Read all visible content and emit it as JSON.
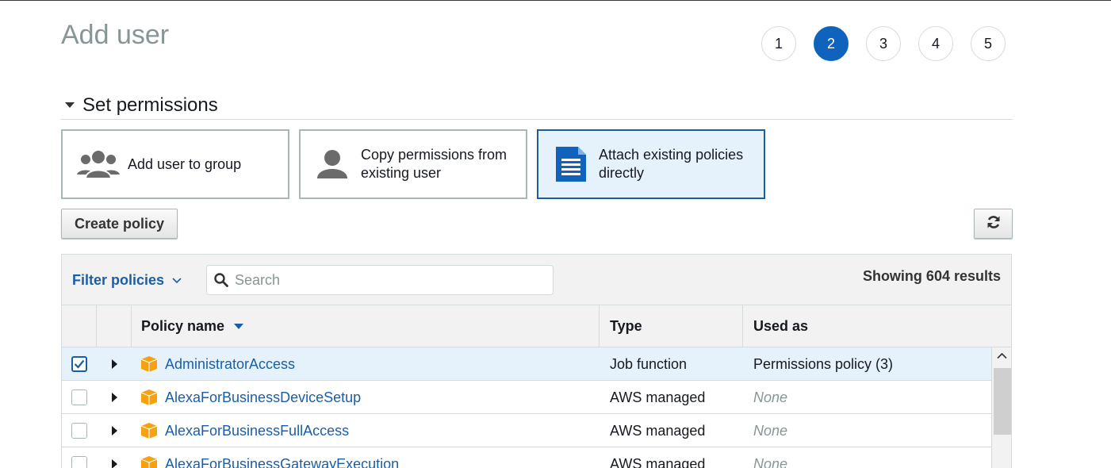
{
  "page": {
    "title": "Add user"
  },
  "steps": [
    {
      "label": "1",
      "active": false
    },
    {
      "label": "2",
      "active": true
    },
    {
      "label": "3",
      "active": false
    },
    {
      "label": "4",
      "active": false
    },
    {
      "label": "5",
      "active": false
    }
  ],
  "section": {
    "title": "Set permissions"
  },
  "options": [
    {
      "label": "Add user to group",
      "icon": "users-group-icon",
      "selected": false
    },
    {
      "label": "Copy permissions from existing user",
      "icon": "user-icon",
      "selected": false
    },
    {
      "label": "Attach existing policies directly",
      "icon": "document-icon",
      "selected": true
    }
  ],
  "toolbar": {
    "create_policy_label": "Create policy",
    "refresh_icon": "refresh-icon"
  },
  "filter": {
    "dropdown_label": "Filter policies",
    "search_placeholder": "Search",
    "results_text": "Showing 604 results"
  },
  "table": {
    "columns": {
      "policy_name": "Policy name",
      "type": "Type",
      "used_as": "Used as"
    },
    "sort_column": "Policy name",
    "rows": [
      {
        "checked": true,
        "name": "AdministratorAccess",
        "type": "Job function",
        "used_as": "Permissions policy (3)"
      },
      {
        "checked": false,
        "name": "AlexaForBusinessDeviceSetup",
        "type": "AWS managed",
        "used_as": "None"
      },
      {
        "checked": false,
        "name": "AlexaForBusinessFullAccess",
        "type": "AWS managed",
        "used_as": "None"
      },
      {
        "checked": false,
        "name": "AlexaForBusinessGatewayExecution",
        "type": "AWS managed",
        "used_as": "None"
      }
    ]
  },
  "colors": {
    "accent": "#0f63bd",
    "link": "#1b5ea8",
    "policy_icon": "#f7a10f",
    "selected_bg": "#e6f2fb"
  }
}
